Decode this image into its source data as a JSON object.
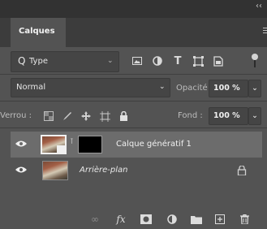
{
  "panel": {
    "collapse_glyph": "‹‹",
    "tab_label": "Calques"
  },
  "filter": {
    "search_glyph": "Q",
    "label": "Type",
    "icons": [
      "image-filter-icon",
      "adjustment-filter-icon",
      "type-filter-icon",
      "shape-filter-icon",
      "smart-object-filter-icon"
    ]
  },
  "blend": {
    "mode": "Normal",
    "opacity_label": "Opacité :",
    "opacity_value": "100 %"
  },
  "locks": {
    "label": "Verrou :",
    "fill_label": "Fond :",
    "fill_value": "100 %"
  },
  "layers": [
    {
      "name": "Calque génératif 1",
      "selected": true,
      "visible": true
    },
    {
      "name": "Arrière-plan",
      "selected": false,
      "visible": true,
      "locked": true
    }
  ],
  "footer": {
    "fx_label": "fx"
  }
}
